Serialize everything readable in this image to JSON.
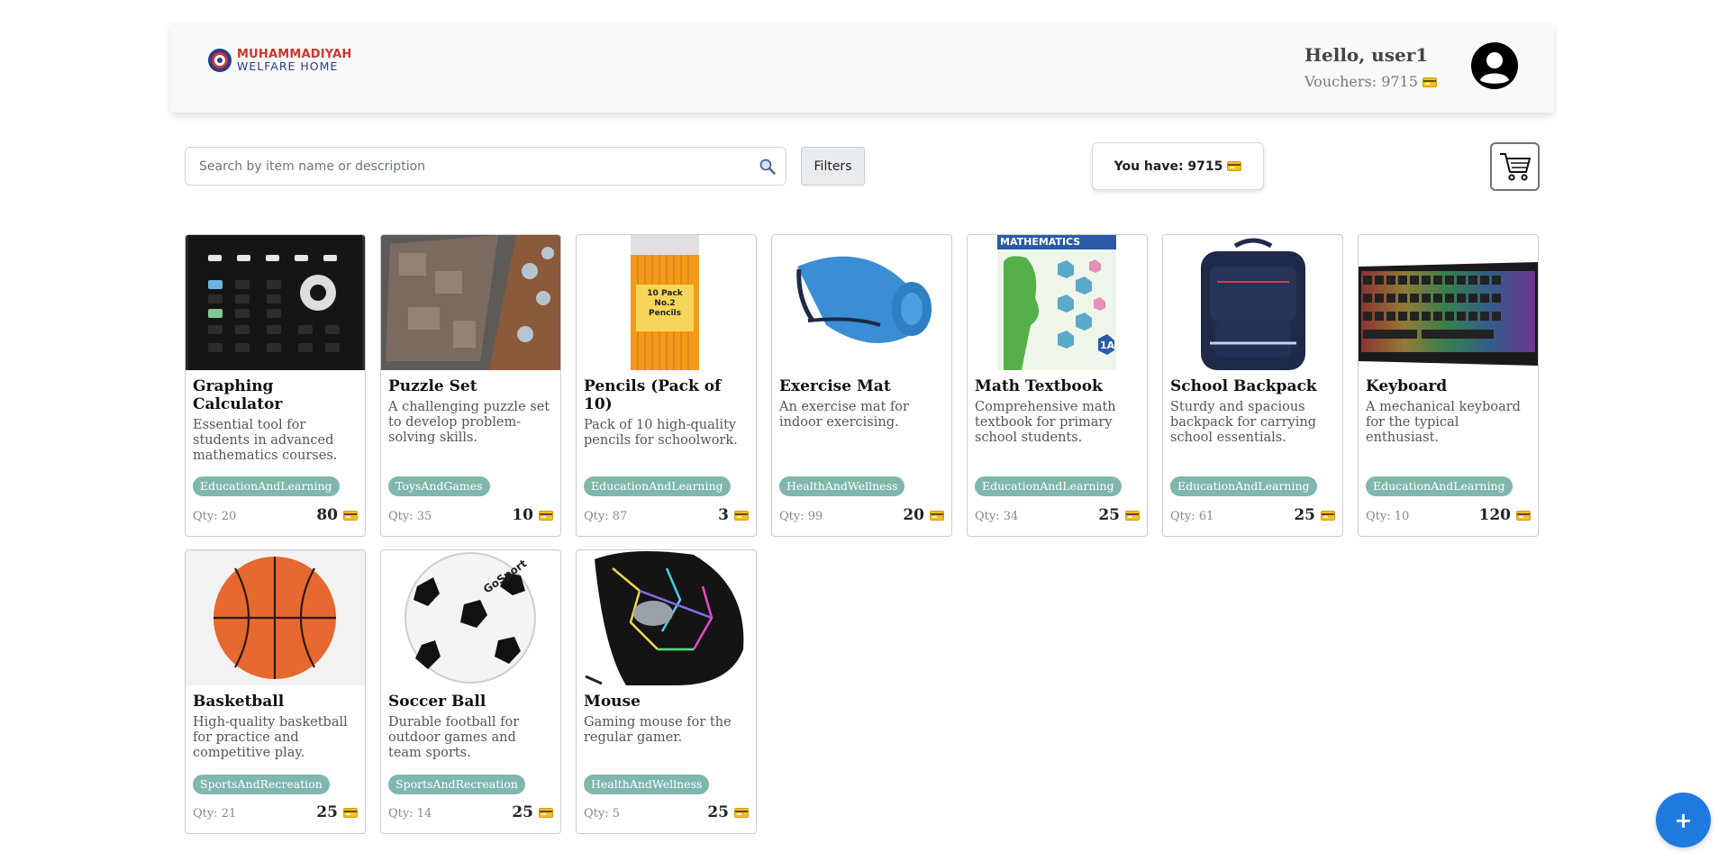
{
  "header": {
    "logo_line1": "MUHAMMADIYAH",
    "logo_line2": "WELFARE HOME",
    "greeting": "Hello, user1",
    "vouchers_label": "Vouchers: 9715"
  },
  "search": {
    "placeholder": "Search by item name or description"
  },
  "toolbar": {
    "filters_label": "Filters",
    "balance_label": "You have: 9715"
  },
  "fab": {
    "label": "+"
  },
  "items": [
    {
      "name": "Graphing Calculator",
      "description": "Essential tool for students in advanced mathematics courses.",
      "category": "EducationAndLearning",
      "qty": "Qty: 20",
      "price": "80"
    },
    {
      "name": "Puzzle Set",
      "description": "A challenging puzzle set to develop problem-solving skills.",
      "category": "ToysAndGames",
      "qty": "Qty: 35",
      "price": "10"
    },
    {
      "name": "Pencils (Pack of 10)",
      "description": "Pack of 10 high-quality pencils for schoolwork.",
      "category": "EducationAndLearning",
      "qty": "Qty: 87",
      "price": "3"
    },
    {
      "name": "Exercise Mat",
      "description": "An exercise mat for indoor exercising.",
      "category": "HealthAndWellness",
      "qty": "Qty: 99",
      "price": "20"
    },
    {
      "name": "Math Textbook",
      "description": "Comprehensive math textbook for primary school students.",
      "category": "EducationAndLearning",
      "qty": "Qty: 34",
      "price": "25"
    },
    {
      "name": "School Backpack",
      "description": "Sturdy and spacious backpack for carrying school essentials.",
      "category": "EducationAndLearning",
      "qty": "Qty: 61",
      "price": "25"
    },
    {
      "name": "Keyboard",
      "description": "A mechanical keyboard for the typical enthusiast.",
      "category": "EducationAndLearning",
      "qty": "Qty: 10",
      "price": "120"
    },
    {
      "name": "Basketball",
      "description": "High-quality basketball for practice and competitive play.",
      "category": "SportsAndRecreation",
      "qty": "Qty: 21",
      "price": "25"
    },
    {
      "name": "Soccer Ball",
      "description": "Durable football for outdoor games and team sports.",
      "category": "SportsAndRecreation",
      "qty": "Qty: 14",
      "price": "25"
    },
    {
      "name": "Mouse",
      "description": "Gaming mouse for the regular gamer.",
      "category": "HealthAndWellness",
      "qty": "Qty: 5",
      "price": "25"
    }
  ],
  "image_text": {
    "pencils_box": "10 Pack No.2 Pencils",
    "textbook_title": "MATHEMATICS",
    "textbook_badge": "1A",
    "soccer_brand": "GoSport"
  },
  "colors": {
    "accent": "#1f7ae0",
    "category_badge": "#7fb7ad",
    "header_bg": "#f8f9fa"
  }
}
